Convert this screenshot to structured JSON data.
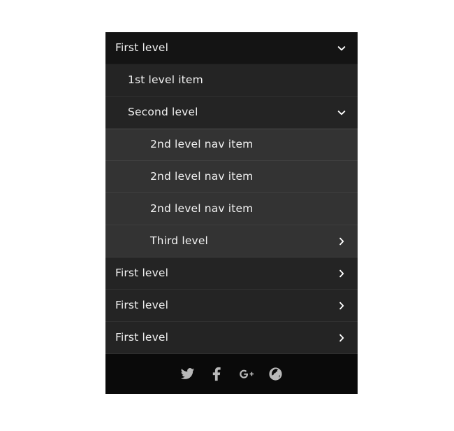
{
  "page": {
    "background_color": "#ffffff"
  },
  "nav": {
    "panel_background": "#242424",
    "header_background": "#141414",
    "level1_background": "#242424",
    "level2_background": "#333333",
    "footer_background": "#0a0a0a",
    "text_color": "#f2f2f2",
    "icon_color": "#b9b9b9",
    "rows": [
      {
        "label": "First level",
        "level": "header",
        "icon": "chevron-down-icon",
        "expanded": true
      },
      {
        "label": "1st level item",
        "level": "level-1",
        "icon": null,
        "expanded": false
      },
      {
        "label": "Second level",
        "level": "level-1",
        "icon": "chevron-down-icon",
        "expanded": true
      },
      {
        "label": "2nd level nav item",
        "level": "level-2",
        "icon": null,
        "expanded": false
      },
      {
        "label": "2nd level nav item",
        "level": "level-2",
        "icon": null,
        "expanded": false
      },
      {
        "label": "2nd level nav item",
        "level": "level-2",
        "icon": null,
        "expanded": false
      },
      {
        "label": "Third level",
        "level": "level-2",
        "icon": "chevron-right-icon",
        "expanded": false
      },
      {
        "label": "First level",
        "level": "level-1-collapsed",
        "icon": "chevron-right-icon",
        "expanded": false
      },
      {
        "label": "First level",
        "level": "level-1-collapsed",
        "icon": "chevron-right-icon",
        "expanded": false
      },
      {
        "label": "First level",
        "level": "level-1-collapsed",
        "icon": "chevron-right-icon",
        "expanded": false
      }
    ],
    "footer": {
      "social_links": [
        {
          "name": "twitter-icon",
          "label": "Twitter"
        },
        {
          "name": "facebook-icon",
          "label": "Facebook"
        },
        {
          "name": "google-plus-icon",
          "label": "Google Plus"
        },
        {
          "name": "globe-icon",
          "label": "Website"
        }
      ]
    }
  }
}
